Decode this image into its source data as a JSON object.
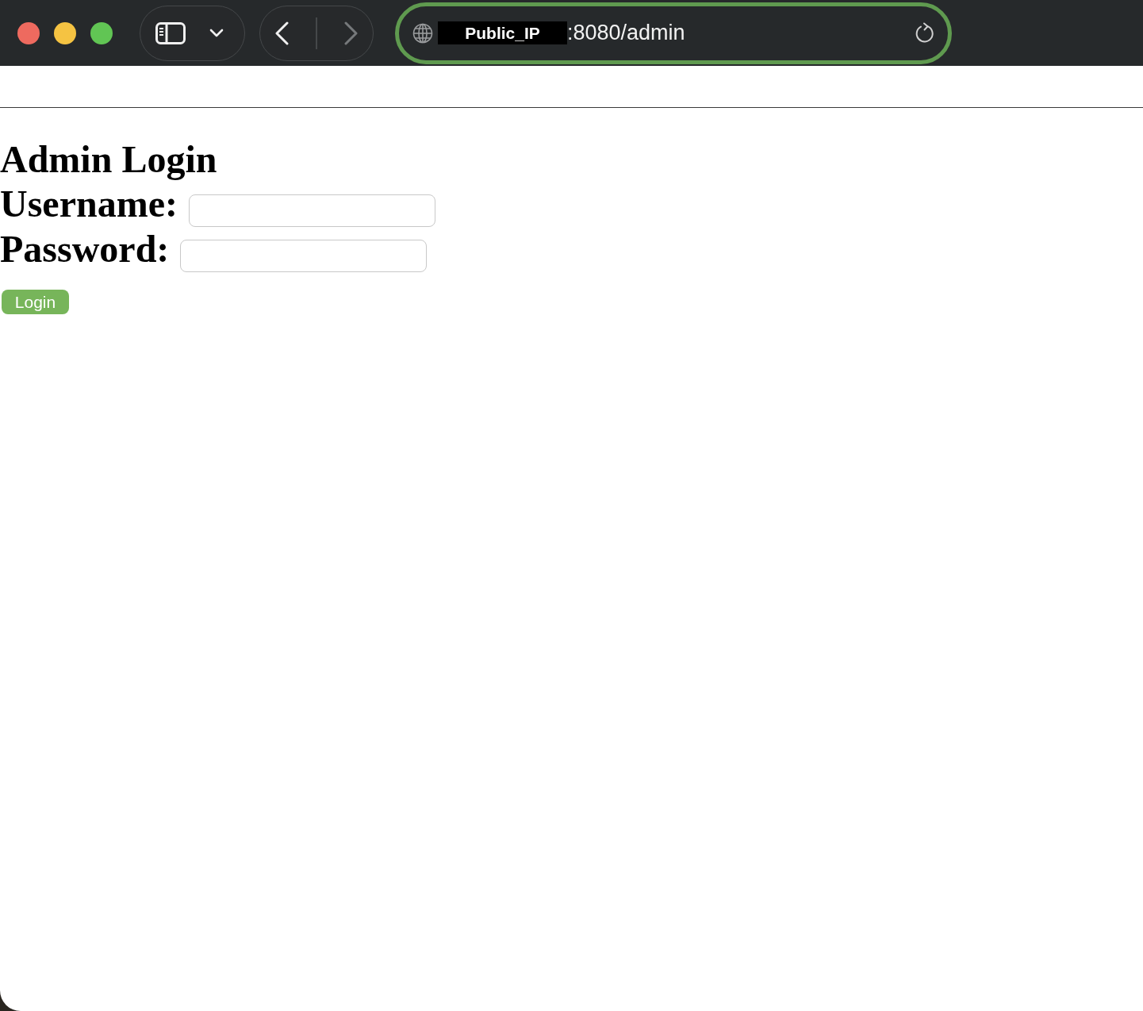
{
  "browser_toolbar": {
    "window_controls": [
      {
        "kind": "close"
      },
      {
        "kind": "minimize"
      },
      {
        "kind": "zoom"
      }
    ],
    "navigation": [
      {
        "kind": "back",
        "disabled": false
      },
      {
        "kind": "forward",
        "disabled": true
      }
    ],
    "address_bar": {
      "focused": true,
      "redacted_host": "Public_IP",
      "path": ":8080/admin"
    }
  },
  "page": {
    "title": "Admin Login",
    "fields": [
      {
        "label": "Username:"
      },
      {
        "label": "Password:"
      }
    ],
    "submit": "Login"
  }
}
